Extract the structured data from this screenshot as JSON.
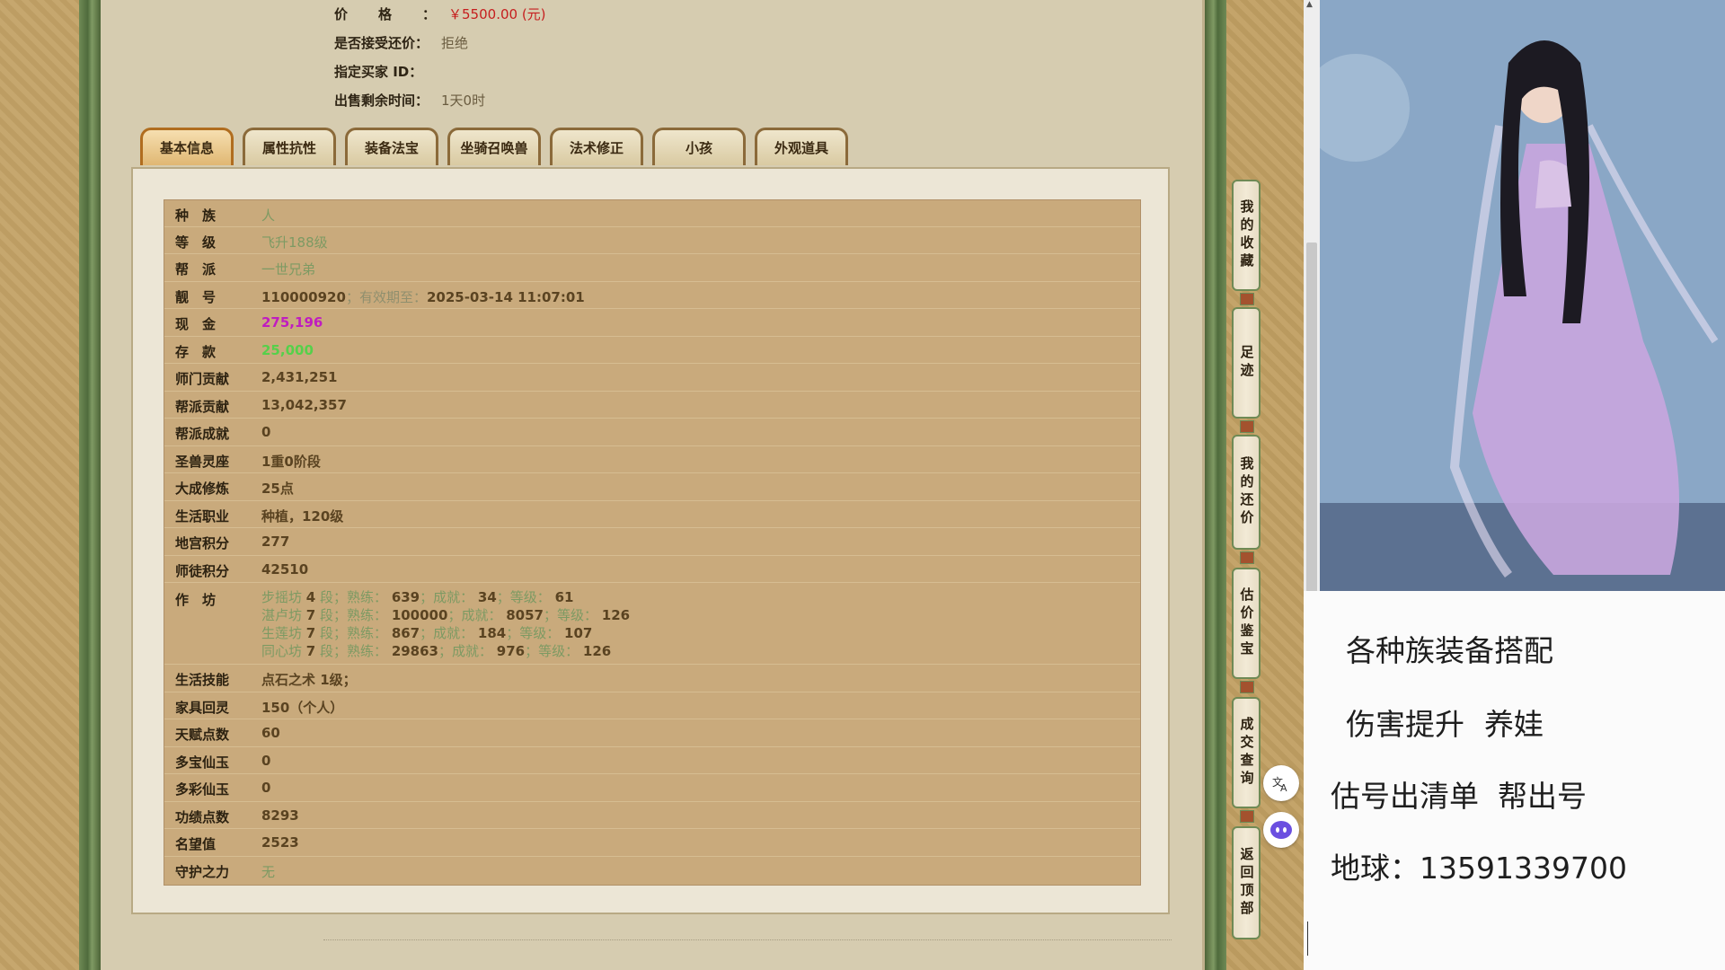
{
  "sale_info": [
    {
      "label": "价格：",
      "value": "￥5500.00 (元)",
      "spread": true
    },
    {
      "label": "是否接受还价：",
      "value": "拒绝"
    },
    {
      "label": "指定买家 ID：",
      "value": ""
    },
    {
      "label": "出售剩余时间：",
      "value": "1天0时"
    }
  ],
  "tabs": [
    "基本信息",
    "属性抗性",
    "装备法宝",
    "坐骑召唤兽",
    "法术修正",
    "小孩",
    "外观道具"
  ],
  "active_tab": "基本信息",
  "table": {
    "race": {
      "label": "种　族",
      "value": "人"
    },
    "level": {
      "label": "等　级",
      "value": "飞升188级"
    },
    "faction": {
      "label": "帮　派",
      "value": "一世兄弟"
    },
    "number": {
      "label": "靓　号",
      "value": "110000920",
      "sep": "；有效期至：",
      "expiry": "2025-03-14 11:07:01"
    },
    "cash": {
      "label": "现　金",
      "value": "275,196"
    },
    "deposit": {
      "label": "存　款",
      "value": "25,000"
    },
    "school_contrib": {
      "label": "师门贡献",
      "value": "2,431,251"
    },
    "gang_contrib": {
      "label": "帮派贡献",
      "value": "13,042,357"
    },
    "gang_achieve": {
      "label": "帮派成就",
      "value": "0"
    },
    "beast_seat": {
      "label": "圣兽灵座",
      "value": "1重0阶段"
    },
    "great_cultivation": {
      "label": "大成修炼",
      "value": "25点"
    },
    "life_job": {
      "label": "生活职业",
      "value": "种植，120级"
    },
    "palace_points": {
      "label": "地宫积分",
      "value": "277"
    },
    "master_points": {
      "label": "师徒积分",
      "value": "42510"
    },
    "workshop": {
      "label": "作　坊",
      "lines": [
        {
          "name": "步摇坊",
          "duan": "4",
          "shu_lbl": "段；熟练：",
          "shu": "639",
          "cj_lbl": "；成就：",
          "cj": "34",
          "dj_lbl": "；等级：",
          "dj": "61"
        },
        {
          "name": "湛卢坊",
          "duan": "7",
          "shu_lbl": "段；熟练：",
          "shu": "100000",
          "cj_lbl": "；成就：",
          "cj": "8057",
          "dj_lbl": "；等级：",
          "dj": "126"
        },
        {
          "name": "生莲坊",
          "duan": "7",
          "shu_lbl": "段；熟练：",
          "shu": "867",
          "cj_lbl": "；成就：",
          "cj": "184",
          "dj_lbl": "；等级：",
          "dj": "107"
        },
        {
          "name": "同心坊",
          "duan": "7",
          "shu_lbl": "段；熟练：",
          "shu": "29863",
          "cj_lbl": "；成就：",
          "cj": "976",
          "dj_lbl": "；等级：",
          "dj": "126"
        }
      ]
    },
    "life_skill": {
      "label": "生活技能",
      "value": "点石之术 1级；"
    },
    "furniture": {
      "label": "家具回灵",
      "value": "150（个人）"
    },
    "talent": {
      "label": "天赋点数",
      "value": "60"
    },
    "duobao_jade": {
      "label": "多宝仙玉",
      "value": "0"
    },
    "duocai_jade": {
      "label": "多彩仙玉",
      "value": "0"
    },
    "merit": {
      "label": "功绩点数",
      "value": "8293"
    },
    "prestige": {
      "label": "名望值",
      "value": "2523"
    },
    "guardian": {
      "label": "守护之力",
      "value": "无"
    }
  },
  "side_menu": [
    "我的收藏",
    "足迹",
    "我的还价",
    "估价鉴宝",
    "成交查询",
    "返回顶部"
  ],
  "ad": {
    "line1": "各种族装备搭配",
    "line2a": "伤害提升",
    "line2b": "养娃",
    "line3a": "估号出清单",
    "line3b": "帮出号",
    "line4": "地球：13591339700"
  }
}
